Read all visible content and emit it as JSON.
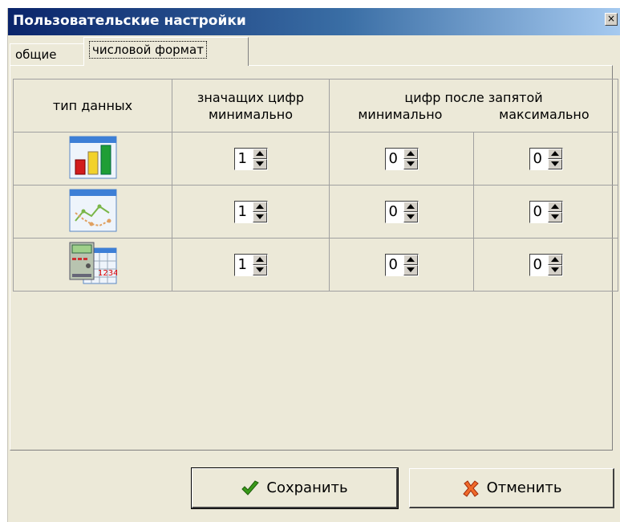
{
  "window": {
    "title": "Пользовательские настройки",
    "close_glyph": "×"
  },
  "tabs": [
    {
      "label": "общие"
    },
    {
      "label": "числовой формат"
    }
  ],
  "table": {
    "col_type": "тип данных",
    "col_significant_line1": "значащих цифр",
    "col_significant_line2": "минимально",
    "col_decimals": "цифр после запятой",
    "col_decimals_min": "минимально",
    "col_decimals_max": "максимально",
    "rows": [
      {
        "icon": "bar-chart-icon",
        "significant_min": "1",
        "decimals_min": "0",
        "decimals_max": "0"
      },
      {
        "icon": "line-chart-icon",
        "significant_min": "1",
        "decimals_min": "0",
        "decimals_max": "0"
      },
      {
        "icon": "calculator-table-icon",
        "significant_min": "1",
        "decimals_min": "0",
        "decimals_max": "0"
      }
    ]
  },
  "buttons": {
    "save_label": "Сохранить",
    "cancel_label": "Отменить"
  }
}
